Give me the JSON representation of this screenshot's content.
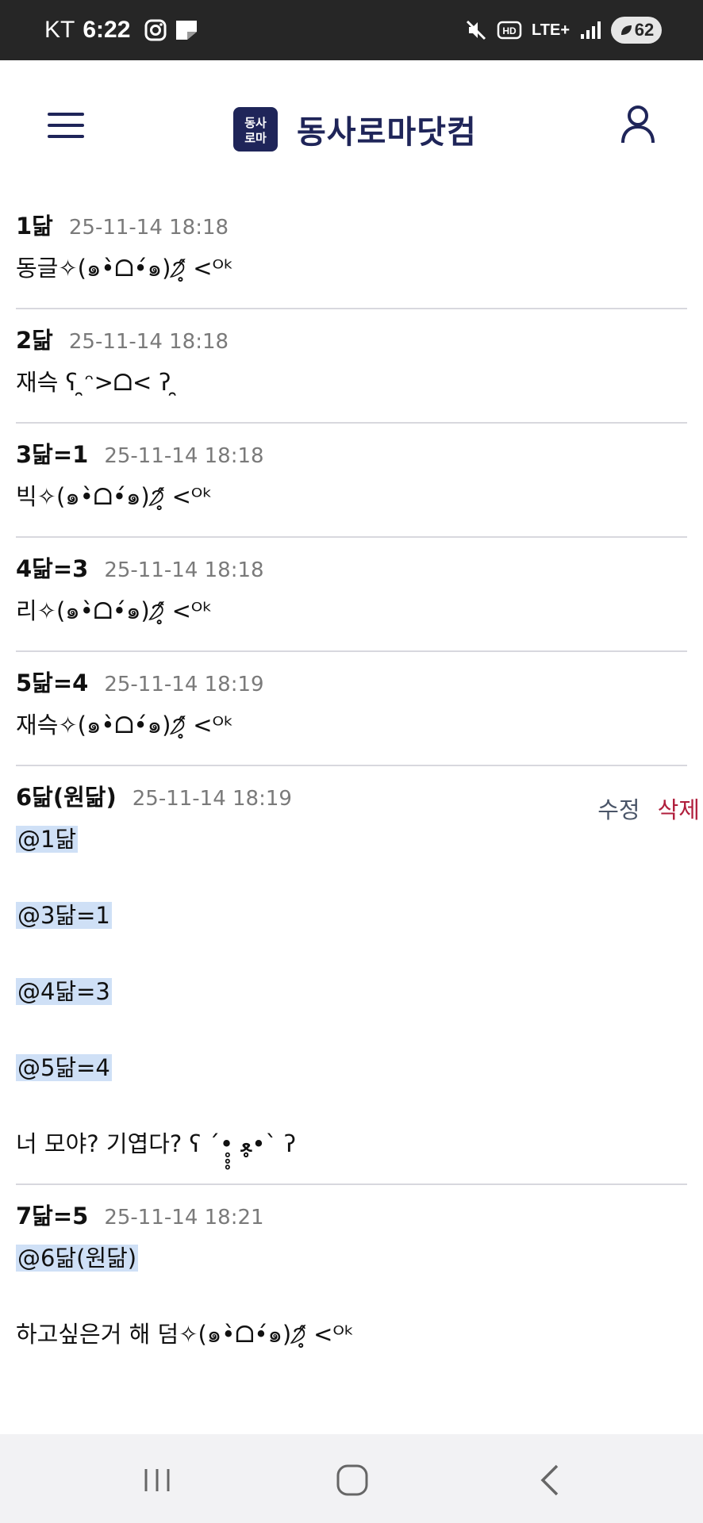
{
  "status_bar": {
    "carrier": "KT",
    "time": "6:22",
    "network": "LTE+",
    "hd_label": "HD",
    "battery": "62"
  },
  "header": {
    "brand_name": "동사로마닷컴",
    "logo_text_top": "동사",
    "logo_text_bottom": "로마"
  },
  "comments": [
    {
      "author": "1닮",
      "time": "25-11-14 18:18",
      "lines": [
        {
          "text": "동글✧(๑•̀ᗝ•́๑)੭̸̥̂ <ᴼᵏ",
          "mention": false
        }
      ]
    },
    {
      "author": "2닮",
      "time": "25-11-14 18:18",
      "lines": [
        {
          "text": "재슥 ʕ ̯ᵔ>ᗝ< ʔ ̯",
          "mention": false
        }
      ]
    },
    {
      "author": "3닮=1",
      "time": "25-11-14 18:18",
      "lines": [
        {
          "text": "빅✧(๑•̀ᗝ•́๑)੭̸̥̂ <ᴼᵏ",
          "mention": false
        }
      ]
    },
    {
      "author": "4닮=3",
      "time": "25-11-14 18:18",
      "lines": [
        {
          "text": "리✧(๑•̀ᗝ•́๑)੭̸̥̂ <ᴼᵏ",
          "mention": false
        }
      ]
    },
    {
      "author": "5닮=4",
      "time": "25-11-14 18:19",
      "lines": [
        {
          "text": "재슥✧(๑•̀ᗝ•́๑)੭̸̥̂ <ᴼᵏ",
          "mention": false
        }
      ]
    },
    {
      "author": "6닮(원닮)",
      "time": "25-11-14 18:19",
      "edit_label": "수정",
      "delete_label": "삭제",
      "lines": [
        {
          "text": "@1닮",
          "mention": true
        },
        {
          "text": "@3닮=1",
          "mention": true
        },
        {
          "text": "@4닮=3",
          "mention": true
        },
        {
          "text": "@5닮=4",
          "mention": true
        },
        {
          "text": "너 모야? 기엽다? ʕ ´•̥̥̥ ﻌ•̥̥̥` ʔ",
          "mention": false
        }
      ]
    },
    {
      "author": "7닮=5",
      "time": "25-11-14 18:21",
      "lines": [
        {
          "text": "@6닮(원닮)",
          "mention": true
        },
        {
          "text": "하고싶은거 해 덤✧(๑•̀ᗝ•́๑)੭̸̥̂ <ᴼᵏ",
          "mention": false
        }
      ]
    }
  ],
  "colors": {
    "brand": "#1f2559",
    "mention_highlight": "#cfe0f6",
    "delete": "#b01e3c",
    "timestamp": "#7a7a7a"
  },
  "icons": {
    "menu": "hamburger-icon",
    "user": "user-icon",
    "nav_recent": "recent-apps-icon",
    "nav_home": "home-icon",
    "nav_back": "back-icon"
  }
}
